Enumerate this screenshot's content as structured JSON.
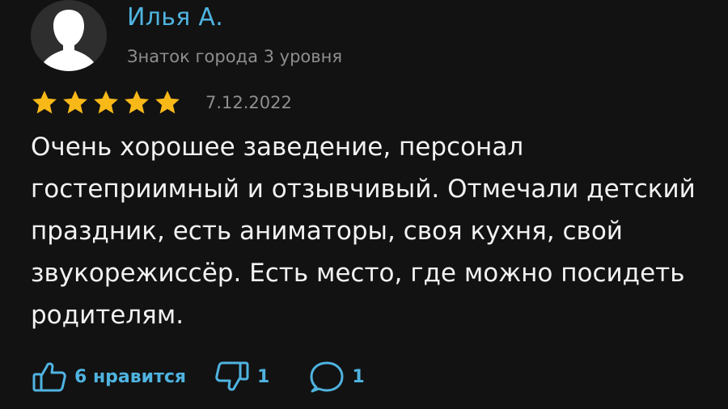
{
  "author": {
    "name": "Илья А.",
    "level": "Знаток города 3 уровня",
    "avatar_icon": "user-silhouette-icon"
  },
  "review": {
    "rating": 5,
    "rating_max": 5,
    "star_color": "#f8b818",
    "date": "7.12.2022",
    "text": "Очень хорошее заведение, персонал гостеприимный и отзывчивый. Отмечали детский праздник, есть аниматоры, своя кухня, свой звукорежиссёр. Есть место, где можно посидеть родителям."
  },
  "actions": {
    "like_label": "6 нравится",
    "dislike_count": "1",
    "comment_count": "1",
    "accent_color": "#4fb3e0"
  }
}
